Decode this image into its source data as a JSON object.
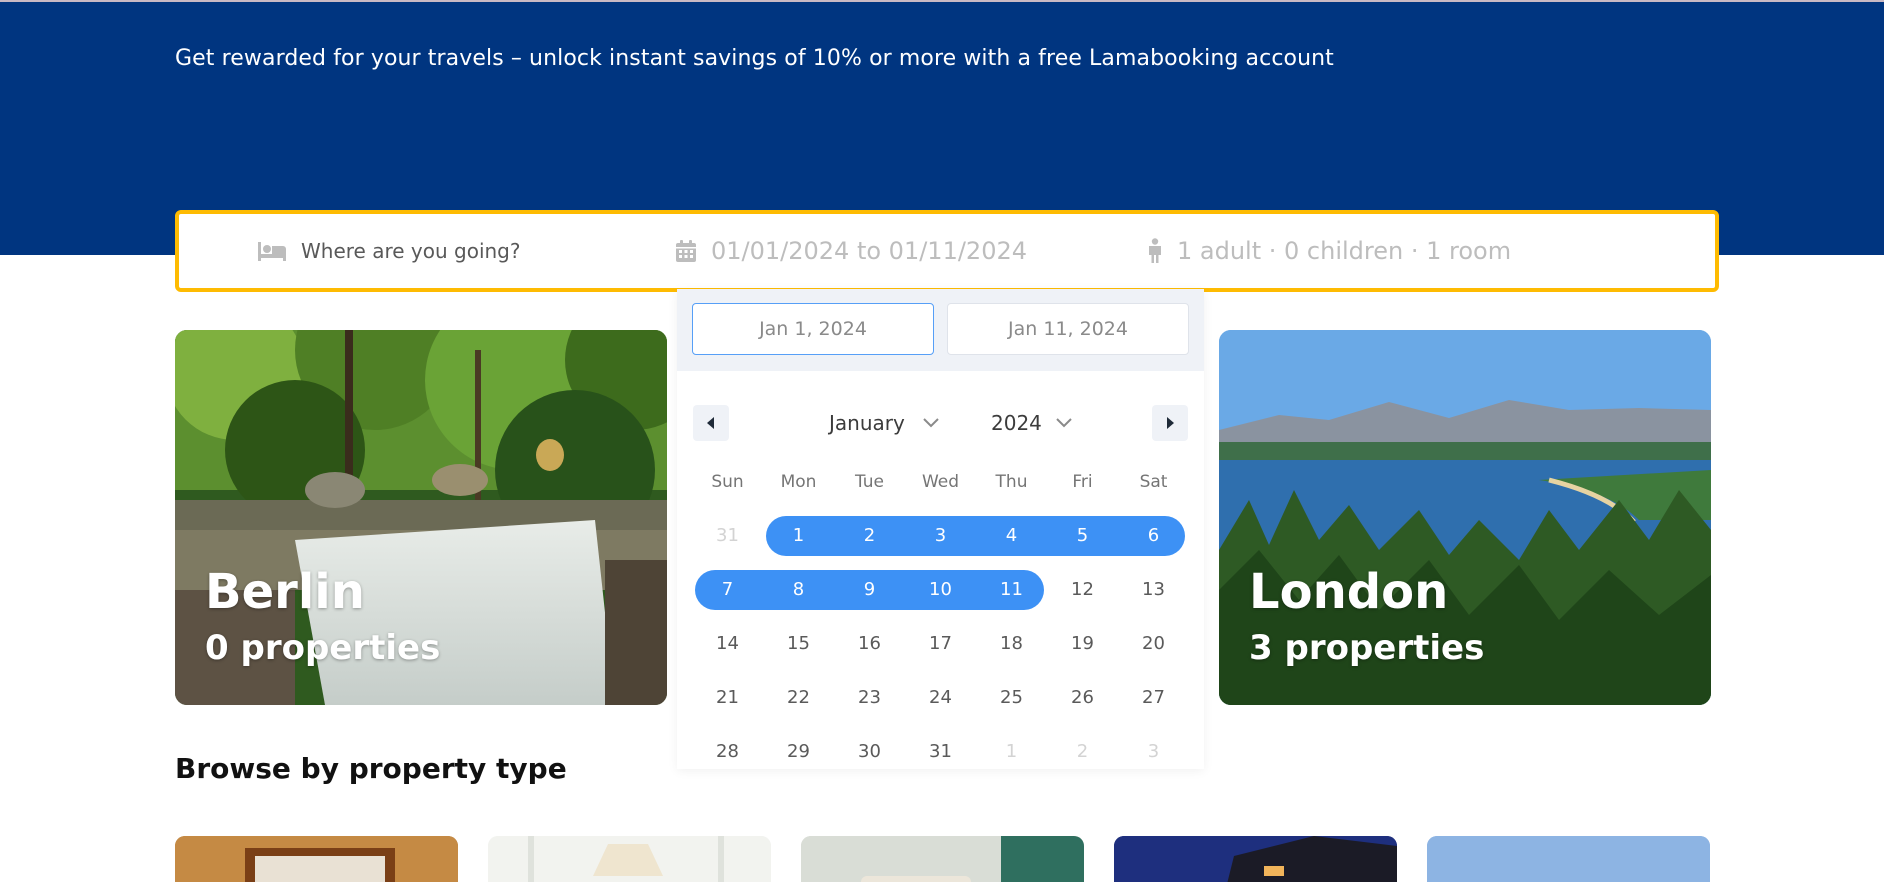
{
  "hero": {
    "promo_text": "Get rewarded for your travels – unlock instant savings of 10% or more with a free Lamabooking account",
    "background_color": "#003580"
  },
  "search": {
    "destination_placeholder": "Where are you going?",
    "destination_icon": "bed-icon",
    "date_range": "01/01/2024 to 01/11/2024",
    "date_icon": "calendar-icon",
    "guests": "1 adult · 0 children · 1 room",
    "guests_icon": "person-icon",
    "border_color": "#febb02"
  },
  "datepicker": {
    "start_input": "Jan 1, 2024",
    "end_input": "Jan 11, 2024",
    "prev_icon": "triangle-left-icon",
    "next_icon": "triangle-right-icon",
    "month": "January",
    "year": "2024",
    "weekdays": [
      "Sun",
      "Mon",
      "Tue",
      "Wed",
      "Thu",
      "Fri",
      "Sat"
    ],
    "selection_color": "#3d91f5",
    "weeks": [
      [
        {
          "d": "31",
          "t": "other"
        },
        {
          "d": "1",
          "t": "sel"
        },
        {
          "d": "2",
          "t": "sel"
        },
        {
          "d": "3",
          "t": "sel"
        },
        {
          "d": "4",
          "t": "sel"
        },
        {
          "d": "5",
          "t": "sel"
        },
        {
          "d": "6",
          "t": "sel"
        }
      ],
      [
        {
          "d": "7",
          "t": "sel"
        },
        {
          "d": "8",
          "t": "sel"
        },
        {
          "d": "9",
          "t": "sel"
        },
        {
          "d": "10",
          "t": "sel"
        },
        {
          "d": "11",
          "t": "sel"
        },
        {
          "d": "12",
          "t": "day"
        },
        {
          "d": "13",
          "t": "day"
        }
      ],
      [
        {
          "d": "14",
          "t": "day"
        },
        {
          "d": "15",
          "t": "day"
        },
        {
          "d": "16",
          "t": "day"
        },
        {
          "d": "17",
          "t": "day"
        },
        {
          "d": "18",
          "t": "day"
        },
        {
          "d": "19",
          "t": "day"
        },
        {
          "d": "20",
          "t": "day"
        }
      ],
      [
        {
          "d": "21",
          "t": "day"
        },
        {
          "d": "22",
          "t": "day"
        },
        {
          "d": "23",
          "t": "day"
        },
        {
          "d": "24",
          "t": "day"
        },
        {
          "d": "25",
          "t": "day"
        },
        {
          "d": "26",
          "t": "day"
        },
        {
          "d": "27",
          "t": "day"
        }
      ],
      [
        {
          "d": "28",
          "t": "day"
        },
        {
          "d": "29",
          "t": "day"
        },
        {
          "d": "30",
          "t": "day"
        },
        {
          "d": "31",
          "t": "day"
        },
        {
          "d": "1",
          "t": "other"
        },
        {
          "d": "2",
          "t": "other"
        },
        {
          "d": "3",
          "t": "other"
        }
      ]
    ]
  },
  "destinations": [
    {
      "name": "Berlin",
      "properties": "0 properties"
    },
    {
      "name": "London",
      "properties": "3 properties"
    }
  ],
  "browse": {
    "title": "Browse by property type"
  }
}
